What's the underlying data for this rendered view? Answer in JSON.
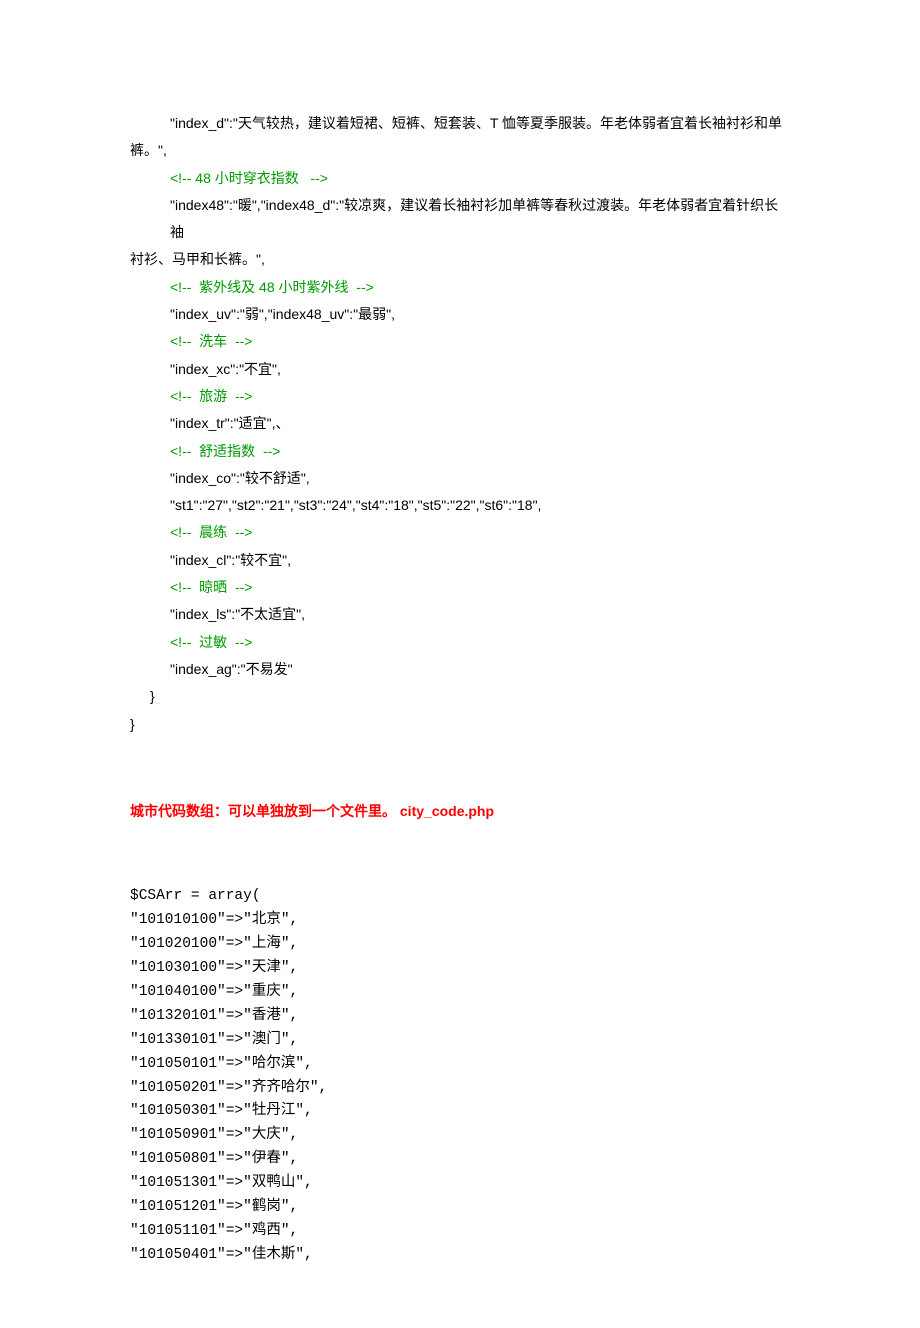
{
  "code_lines": [
    {
      "cls": "indent-1",
      "segs": [
        {
          "t": "\"index_d\":\"天气较热，建议着短裙、短裤、短套装、T 恤等夏季服装。年老体弱者宜着长袖衬衫和单"
        }
      ]
    },
    {
      "cls": "no-indent",
      "segs": [
        {
          "t": "裤。\","
        }
      ]
    },
    {
      "cls": "indent-1",
      "segs": [
        {
          "t": "<!-- 48 小时穿衣指数   -->",
          "c": true
        }
      ]
    },
    {
      "cls": "indent-1",
      "segs": [
        {
          "t": "\"index48\":\"暖\",\"index48_d\":\"较凉爽，建议着长袖衬衫加单裤等春秋过渡装。年老体弱者宜着针织长袖"
        }
      ]
    },
    {
      "cls": "no-indent",
      "segs": [
        {
          "t": "衬衫、马甲和长裤。\","
        }
      ]
    },
    {
      "cls": "indent-1",
      "segs": [
        {
          "t": "<!--  紫外线及 48 小时紫外线  -->",
          "c": true
        }
      ]
    },
    {
      "cls": "indent-1",
      "segs": [
        {
          "t": "\"index_uv\":\"弱\",\"index48_uv\":\"最弱\","
        }
      ]
    },
    {
      "cls": "indent-1",
      "segs": [
        {
          "t": "<!--  洗车  -->",
          "c": true
        }
      ]
    },
    {
      "cls": "indent-1",
      "segs": [
        {
          "t": "\"index_xc\":\"不宜\","
        }
      ]
    },
    {
      "cls": "indent-1",
      "segs": [
        {
          "t": "<!--  旅游  -->",
          "c": true
        }
      ]
    },
    {
      "cls": "indent-1",
      "segs": [
        {
          "t": "\"index_tr\":\"适宜\",、"
        }
      ]
    },
    {
      "cls": "indent-1",
      "segs": [
        {
          "t": "<!--  舒适指数  -->",
          "c": true
        }
      ]
    },
    {
      "cls": "indent-1",
      "segs": [
        {
          "t": "\"index_co\":\"较不舒适\","
        }
      ]
    },
    {
      "cls": "indent-1",
      "segs": [
        {
          "t": "\"st1\":\"27\",\"st2\":\"21\",\"st3\":\"24\",\"st4\":\"18\",\"st5\":\"22\",\"st6\":\"18\","
        }
      ]
    },
    {
      "cls": "indent-1",
      "segs": [
        {
          "t": "<!--  晨练  -->",
          "c": true
        }
      ]
    },
    {
      "cls": "indent-1",
      "segs": [
        {
          "t": "\"index_cl\":\"较不宜\","
        }
      ]
    },
    {
      "cls": "indent-1",
      "segs": [
        {
          "t": "<!--  晾晒  -->",
          "c": true
        }
      ]
    },
    {
      "cls": "indent-1",
      "segs": [
        {
          "t": "\"index_ls\":\"不太适宜\","
        }
      ]
    },
    {
      "cls": "indent-1",
      "segs": [
        {
          "t": "<!--  过敏  -->",
          "c": true
        }
      ]
    },
    {
      "cls": "indent-1",
      "segs": [
        {
          "t": "\"index_ag\":\"不易发\""
        }
      ]
    },
    {
      "cls": "indent-2",
      "segs": [
        {
          "t": "}"
        }
      ]
    },
    {
      "cls": "no-indent",
      "segs": [
        {
          "t": "}"
        }
      ]
    }
  ],
  "heading": "城市代码数组：可以单独放到一个文件里。  city_code.php",
  "php_lines": [
    "$CSArr = array(",
    "\"101010100\"=>\"北京\",",
    "\"101020100\"=>\"上海\",",
    "\"101030100\"=>\"天津\",",
    "\"101040100\"=>\"重庆\",",
    "\"101320101\"=>\"香港\",",
    "\"101330101\"=>\"澳门\",",
    "\"101050101\"=>\"哈尔滨\",",
    "\"101050201\"=>\"齐齐哈尔\",",
    "\"101050301\"=>\"牡丹江\",",
    "\"101050901\"=>\"大庆\",",
    "\"101050801\"=>\"伊春\",",
    "\"101051301\"=>\"双鸭山\",",
    "\"101051201\"=>\"鹤岗\",",
    "\"101051101\"=>\"鸡西\",",
    "\"101050401\"=>\"佳木斯\","
  ]
}
